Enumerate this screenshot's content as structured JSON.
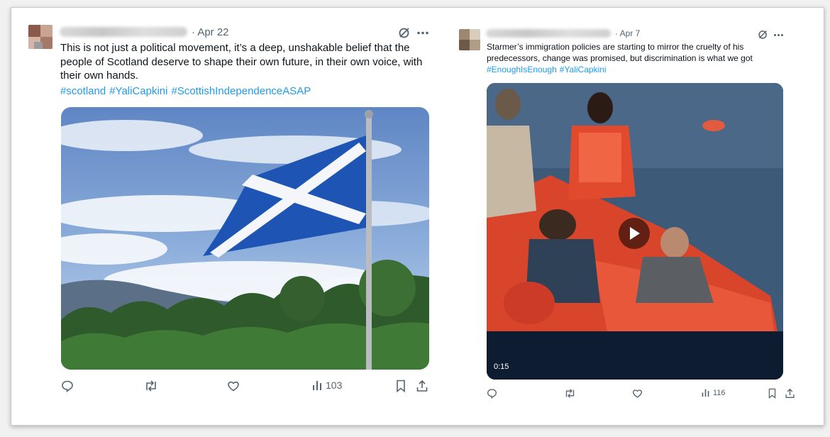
{
  "left_tweet": {
    "date": "· Apr 22",
    "text": "This is not just a political movement, it’s a deep, unshakable belief that the people of Scotland deserve to shape their own future, in their own voice, with their own hands.",
    "hashtags": [
      "#scotland",
      "#YaliCapkini",
      "#ScottishIndependenceASAP"
    ],
    "media_icon": "scotland-flag-photo",
    "views": "103",
    "icons": [
      "grok-icon",
      "more-icon",
      "reply-icon",
      "retweet-icon",
      "like-icon",
      "views-icon",
      "bookmark-icon",
      "share-icon"
    ]
  },
  "right_tweet": {
    "date": "· Apr 7",
    "text": "Starmer’s immigration policies are starting to mirror the cruelty of his predecessors, change was promised, but discrimination is what we got",
    "hashtags": [
      "#EnoughIsEnough",
      "#YaliCapkini"
    ],
    "video_duration": "0:15",
    "media_icon": "rescue-boat-video",
    "views": "116",
    "icons": [
      "grok-icon",
      "more-icon",
      "play-icon",
      "reply-icon",
      "retweet-icon",
      "like-icon",
      "views-icon",
      "bookmark-icon",
      "share-icon"
    ]
  },
  "colors": {
    "hashtag": "#1d9bf0",
    "secondary_text": "#536471",
    "primary_text": "#0f1419"
  }
}
